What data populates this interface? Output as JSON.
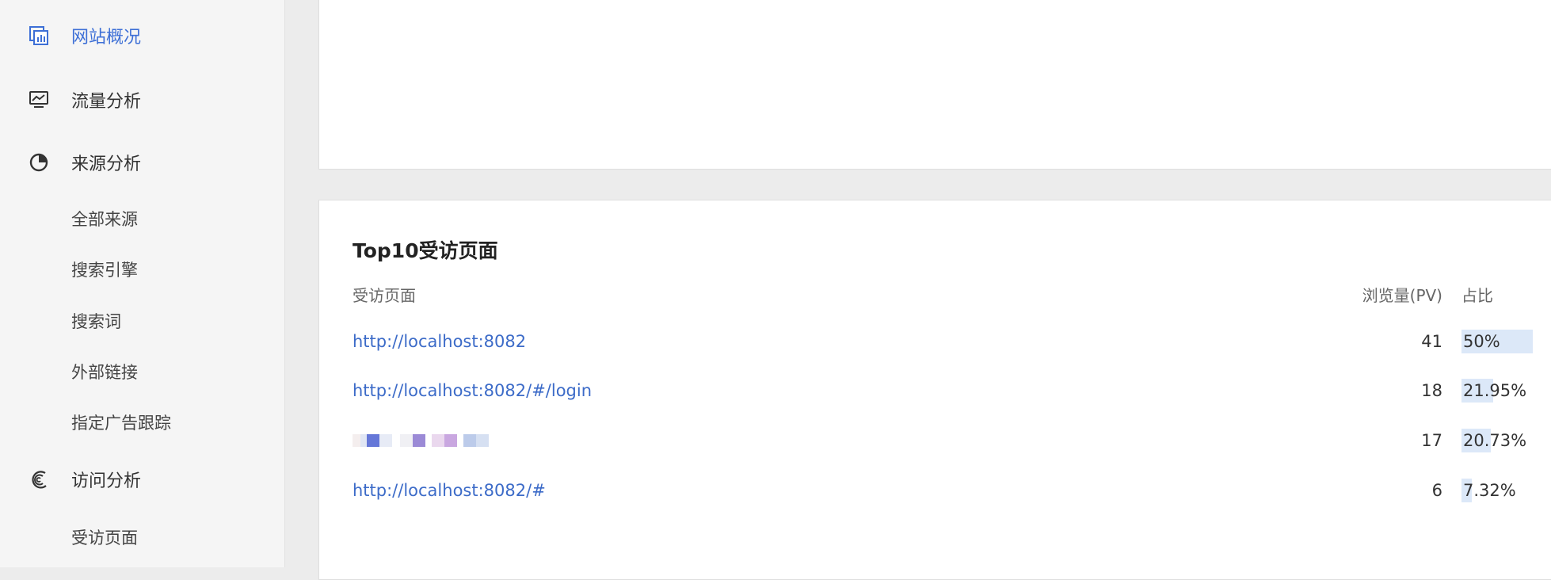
{
  "sidebar": {
    "items": [
      {
        "label": "网站概况",
        "icon": "overview-icon",
        "active": true
      },
      {
        "label": "流量分析",
        "icon": "monitor-chart-icon",
        "active": false
      },
      {
        "label": "来源分析",
        "icon": "pie-chart-icon",
        "active": false
      }
    ],
    "source_sub": [
      "全部来源",
      "搜索引擎",
      "搜索词",
      "外部链接",
      "指定广告跟踪"
    ],
    "visit": {
      "label": "访问分析",
      "icon": "spiral-icon"
    },
    "visit_sub": [
      "受访页面"
    ]
  },
  "top_pages": {
    "title": "Top10受访页面",
    "columns": {
      "page": "受访页面",
      "pv": "浏览量(PV)",
      "ratio": "占比"
    },
    "rows": [
      {
        "url": "http://localhost:8082",
        "pv": "41",
        "ratio": "50%",
        "ratio_value": 0.5
      },
      {
        "url": "http://localhost:8082/#/login",
        "pv": "18",
        "ratio": "21.95%",
        "ratio_value": 0.2195
      },
      {
        "url": "",
        "pv": "17",
        "ratio": "20.73%",
        "ratio_value": 0.2073,
        "redacted": true
      },
      {
        "url": "http://localhost:8082/#",
        "pv": "6",
        "ratio": "7.32%",
        "ratio_value": 0.0732
      }
    ]
  },
  "colors": {
    "accent": "#3d6fd6",
    "link": "#3c6bc8",
    "ratio_bar": "#dce8f8"
  }
}
